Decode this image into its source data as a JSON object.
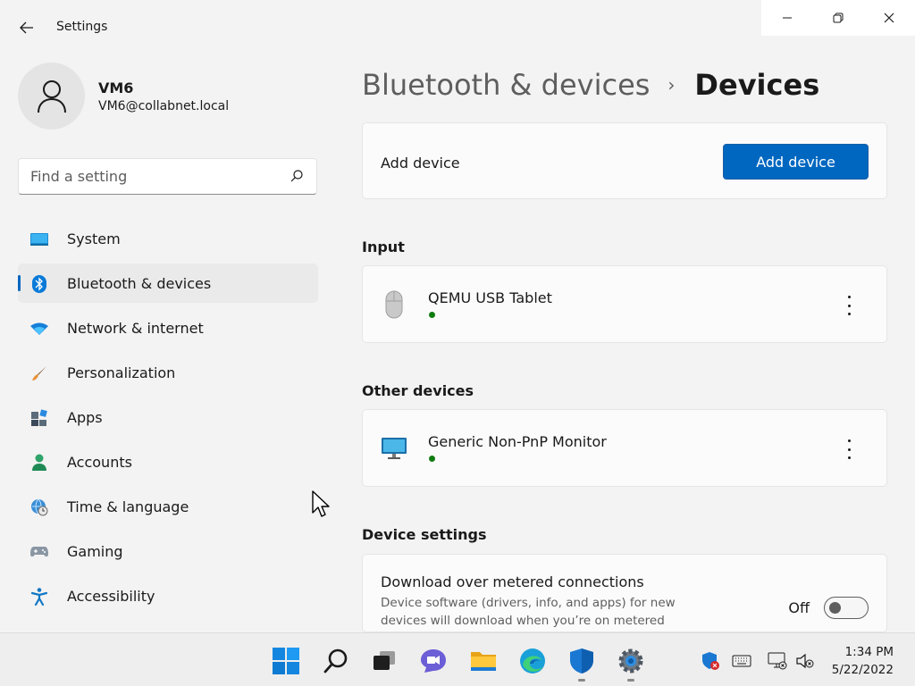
{
  "window": {
    "app_title": "Settings",
    "back_icon": "arrow-left-icon",
    "minimize_icon": "minimize-icon",
    "restore_icon": "restore-icon",
    "close_icon": "close-icon"
  },
  "profile": {
    "name": "VM6",
    "email": "VM6@collabnet.local",
    "avatar_icon": "person-icon"
  },
  "search": {
    "placeholder": "Find a setting",
    "value": "",
    "icon": "search-icon"
  },
  "nav": {
    "items": [
      {
        "label": "System",
        "icon": "system-icon",
        "selected": false
      },
      {
        "label": "Bluetooth & devices",
        "icon": "bluetooth-icon",
        "selected": true
      },
      {
        "label": "Network & internet",
        "icon": "wifi-icon",
        "selected": false
      },
      {
        "label": "Personalization",
        "icon": "paintbrush-icon",
        "selected": false
      },
      {
        "label": "Apps",
        "icon": "apps-icon",
        "selected": false
      },
      {
        "label": "Accounts",
        "icon": "accounts-icon",
        "selected": false
      },
      {
        "label": "Time & language",
        "icon": "globe-clock-icon",
        "selected": false
      },
      {
        "label": "Gaming",
        "icon": "gamepad-icon",
        "selected": false
      },
      {
        "label": "Accessibility",
        "icon": "accessibility-icon",
        "selected": false
      }
    ]
  },
  "breadcrumb": {
    "parent": "Bluetooth & devices",
    "separator": "›",
    "current": "Devices"
  },
  "add_device": {
    "label": "Add device",
    "button_label": "Add device"
  },
  "sections": {
    "input": {
      "title": "Input",
      "devices": [
        {
          "name": "QEMU USB Tablet",
          "icon": "mouse-icon",
          "status": "connected"
        }
      ]
    },
    "other": {
      "title": "Other devices",
      "devices": [
        {
          "name": "Generic Non-PnP Monitor",
          "icon": "monitor-icon",
          "status": "connected"
        }
      ]
    },
    "device_settings": {
      "title": "Device settings",
      "metered": {
        "title": "Download over metered connections",
        "description": "Device software (drivers, info, and apps) for new devices will download when you’re on metered",
        "toggle_state": "Off",
        "enabled": false
      }
    }
  },
  "taskbar": {
    "apps": [
      {
        "name": "Start",
        "icon": "windows-start-icon"
      },
      {
        "name": "Search",
        "icon": "search-icon"
      },
      {
        "name": "Task View",
        "icon": "task-view-icon"
      },
      {
        "name": "Chat",
        "icon": "chat-icon"
      },
      {
        "name": "File Explorer",
        "icon": "folder-icon"
      },
      {
        "name": "Microsoft Edge",
        "icon": "edge-icon"
      },
      {
        "name": "Windows Security",
        "icon": "shield-icon"
      },
      {
        "name": "Settings",
        "icon": "gear-icon"
      }
    ],
    "tray": [
      "security-warning-icon",
      "keyboard-icon",
      "network-icon",
      "volume-muted-icon"
    ],
    "time": "1:34 PM",
    "date": "5/22/2022"
  },
  "colors": {
    "accent": "#0067c0",
    "status_connected": "#107c10",
    "background": "#f3f3f3",
    "card": "#fbfbfb"
  }
}
